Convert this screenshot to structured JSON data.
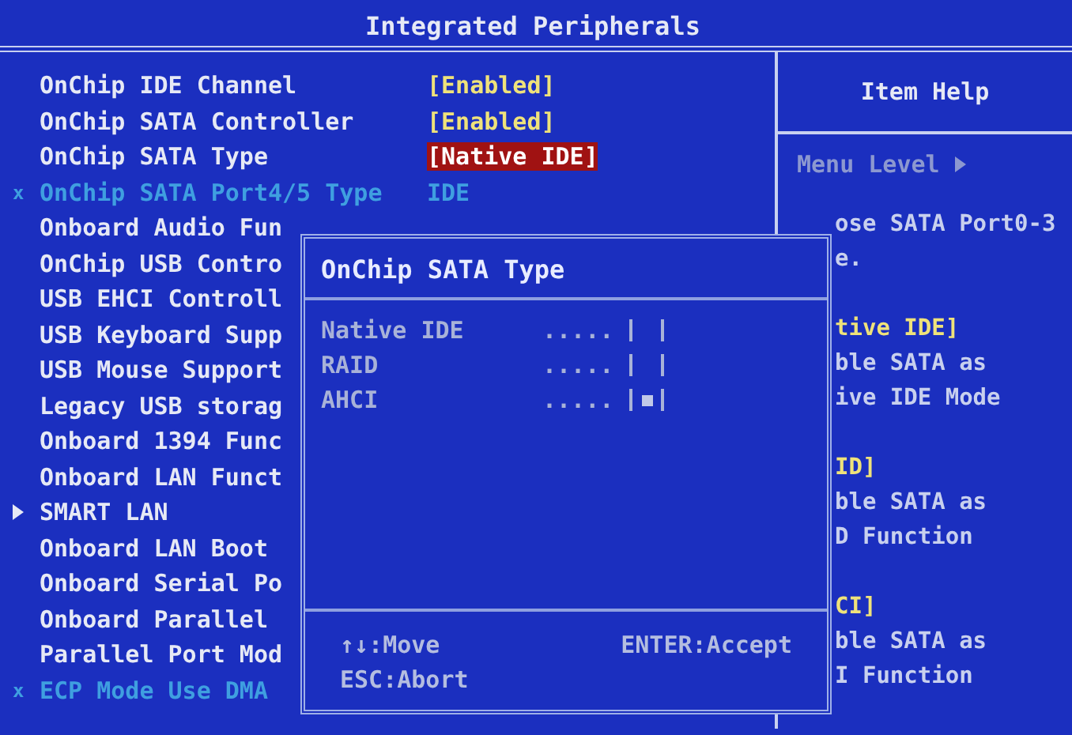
{
  "window": {
    "title": "Integrated Peripherals"
  },
  "settings": [
    {
      "kind": "normal",
      "label": "OnChip IDE Channel",
      "value": "[Enabled]",
      "selected": false
    },
    {
      "kind": "normal",
      "label": "OnChip SATA Controller",
      "value": "[Enabled]",
      "selected": false
    },
    {
      "kind": "normal",
      "label": "OnChip SATA Type",
      "value": "[Native IDE]",
      "selected": true
    },
    {
      "kind": "disabled",
      "marker": "x",
      "label": "OnChip SATA Port4/5 Type",
      "value": "IDE",
      "selected": false
    },
    {
      "kind": "normal",
      "label": "Onboard Audio Fun"
    },
    {
      "kind": "normal",
      "label": "OnChip USB Contro"
    },
    {
      "kind": "normal",
      "label": "USB EHCI Controll"
    },
    {
      "kind": "normal",
      "label": "USB Keyboard Supp"
    },
    {
      "kind": "normal",
      "label": "USB Mouse Support"
    },
    {
      "kind": "normal",
      "label": "Legacy USB storag"
    },
    {
      "kind": "normal",
      "label": "Onboard 1394 Func"
    },
    {
      "kind": "normal",
      "label": "Onboard LAN Funct"
    },
    {
      "kind": "submenu",
      "label": "SMART LAN"
    },
    {
      "kind": "normal",
      "label": "Onboard LAN Boot"
    },
    {
      "kind": "normal",
      "label": "Onboard Serial Po"
    },
    {
      "kind": "normal",
      "label": "Onboard Parallel"
    },
    {
      "kind": "normal",
      "label": "Parallel Port Mod"
    },
    {
      "kind": "disabled",
      "marker": "x",
      "label": "ECP Mode Use DMA"
    }
  ],
  "item_help": {
    "title": "Item Help",
    "menu_level": "Menu Level",
    "lines": [
      {
        "kind": "text",
        "text": "ose SATA Port0-3"
      },
      {
        "kind": "text",
        "text": "e."
      },
      {
        "kind": "heading",
        "text": "tive IDE]"
      },
      {
        "kind": "text",
        "text": "ble SATA as"
      },
      {
        "kind": "text",
        "text": "ive IDE Mode"
      },
      {
        "kind": "heading",
        "text": "ID]"
      },
      {
        "kind": "text",
        "text": "ble SATA as"
      },
      {
        "kind": "text",
        "text": "D Function"
      },
      {
        "kind": "heading",
        "text": "CI]"
      },
      {
        "kind": "text",
        "text": "ble SATA as"
      },
      {
        "kind": "text",
        "text": "I Function"
      }
    ]
  },
  "dialog": {
    "title": "OnChip SATA Type",
    "options": [
      {
        "label": "Native IDE",
        "leader": ".....",
        "selected": false
      },
      {
        "label": "RAID",
        "leader": ".....",
        "selected": false
      },
      {
        "label": "AHCI",
        "leader": ".....",
        "selected": true
      }
    ],
    "hints": [
      "↑↓:Move",
      "ENTER:Accept",
      "ESC:Abort"
    ]
  }
}
